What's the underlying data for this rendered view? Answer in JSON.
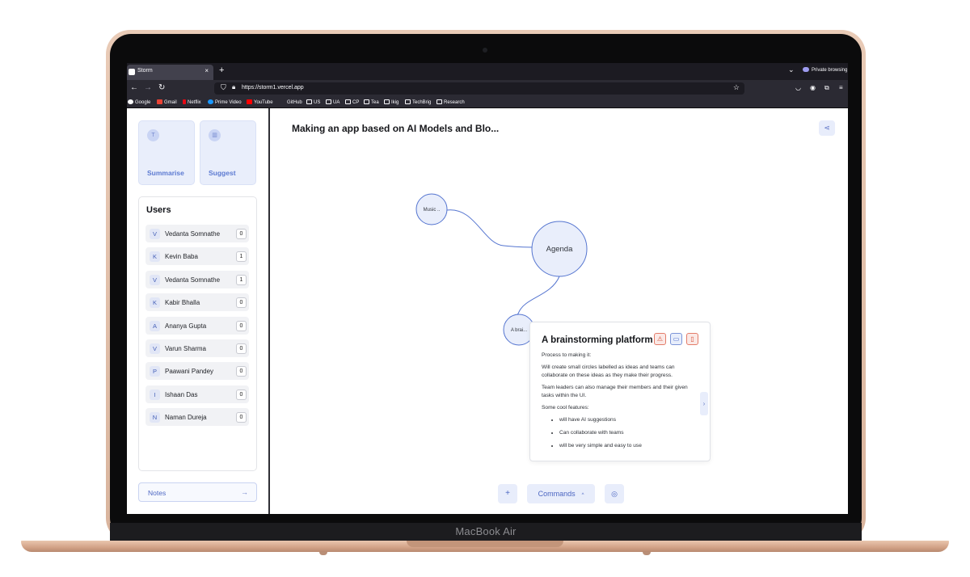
{
  "device": {
    "brand": "MacBook Air"
  },
  "browser": {
    "tab": {
      "title": "Storm",
      "close": "×",
      "new_tab": "+"
    },
    "private_label": "Private browsing",
    "url": "https://storm1.vercel.app",
    "bookmarks": [
      {
        "label": "Google",
        "icon": "google-icon",
        "color": "#ffffff"
      },
      {
        "label": "Gmail",
        "icon": "gmail-icon",
        "color": "#ea4335"
      },
      {
        "label": "Netflix",
        "icon": "netflix-icon",
        "color": "#e50914"
      },
      {
        "label": "Prime Video",
        "icon": "prime-video-icon",
        "color": "#1a98ff"
      },
      {
        "label": "YouTube",
        "icon": "youtube-icon",
        "color": "#ff0000"
      },
      {
        "label": "GitHub",
        "icon": "github-icon",
        "color": "#2b2a33"
      },
      {
        "label": "US",
        "icon": "folder-icon",
        "color": "#2b2a33"
      },
      {
        "label": "UA",
        "icon": "folder-icon",
        "color": "#2b2a33"
      },
      {
        "label": "CP",
        "icon": "folder-icon",
        "color": "#2b2a33"
      },
      {
        "label": "Tea",
        "icon": "folder-icon",
        "color": "#2b2a33"
      },
      {
        "label": "Ikig",
        "icon": "folder-icon",
        "color": "#2b2a33"
      },
      {
        "label": "TechBrig",
        "icon": "folder-icon",
        "color": "#2b2a33"
      },
      {
        "label": "Research",
        "icon": "folder-icon",
        "color": "#2b2a33"
      }
    ]
  },
  "sidebar": {
    "actions": [
      {
        "label": "Summarise",
        "icon": "text-icon"
      },
      {
        "label": "Suggest",
        "icon": "chart-icon"
      }
    ],
    "users_title": "Users",
    "users": [
      {
        "initial": "V",
        "name": "Vedanta Somnathe",
        "count": "0"
      },
      {
        "initial": "K",
        "name": "Kevin Baba",
        "count": "1"
      },
      {
        "initial": "V",
        "name": "Vedanta Somnathe",
        "count": "1"
      },
      {
        "initial": "K",
        "name": "Kabir Bhalla",
        "count": "0"
      },
      {
        "initial": "A",
        "name": "Ananya Gupta",
        "count": "0"
      },
      {
        "initial": "V",
        "name": "Varun Sharma",
        "count": "0"
      },
      {
        "initial": "P",
        "name": "Paawani Pandey",
        "count": "0"
      },
      {
        "initial": "I",
        "name": "Ishaan Das",
        "count": "0"
      },
      {
        "initial": "N",
        "name": "Naman Dureja",
        "count": "0"
      }
    ],
    "notes_label": "Notes",
    "notes_arrow": "→"
  },
  "main": {
    "title": "Making an app based on AI Models and Blo...",
    "nodes": {
      "music": "Music ..",
      "agenda": "Agenda",
      "brainstorm": "A brai..."
    },
    "popup": {
      "title": "A brainstorming platform",
      "body": [
        "Process to making it:",
        "Will create small circles labelled as ideas and teams can collaborate on these ideas as they make their progress.",
        "Team leaders can also manage their members and their given tasks within the UI.",
        "Some cool features:"
      ],
      "bullets": [
        "will have AI suggestions",
        "Can collaborate with teams",
        "will be very simple and easy to use"
      ],
      "next": "›"
    },
    "toolbar": {
      "add": "+",
      "commands": "Commands",
      "commands_caret": "^"
    }
  },
  "colors": {
    "accent": "#4c66c2",
    "node_stroke": "#5575d0",
    "node_fill": "#e9eefb",
    "warning": "#d4523c"
  }
}
